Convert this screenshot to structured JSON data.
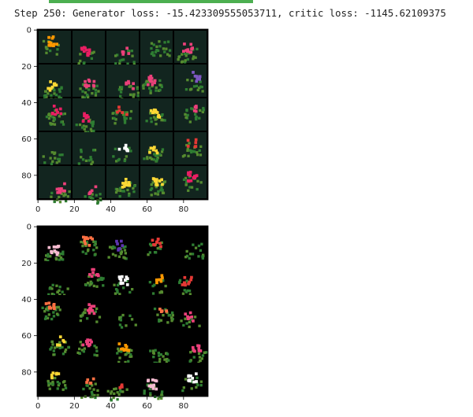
{
  "progress": {
    "fraction": 1.0,
    "color": "#4caf50"
  },
  "log": {
    "text": "Step 250: Generator loss: -15.423309555053711, critic loss: -1145.62109375"
  },
  "plots": [
    {
      "name": "generated-samples",
      "x_ticks": [
        "0",
        "20",
        "40",
        "60",
        "80"
      ],
      "y_ticks": [
        "0",
        "20",
        "40",
        "60",
        "80"
      ],
      "grid": {
        "rows": 5,
        "cols": 5
      },
      "tile_background": "#12251f",
      "frame_background": "#000000",
      "palette": [
        "#e53935",
        "#fdd835",
        "#ffffff",
        "#7e57c2",
        "#ec407a",
        "#ff9800",
        "#e91e63"
      ]
    },
    {
      "name": "real-samples",
      "x_ticks": [
        "0",
        "20",
        "40",
        "60",
        "80"
      ],
      "y_ticks": [
        "0",
        "20",
        "40",
        "60",
        "80"
      ],
      "grid": {
        "rows": 5,
        "cols": 5
      },
      "tile_background": "#000000",
      "frame_background": "#000000",
      "palette": [
        "#ec407a",
        "#fdd835",
        "#ff7043",
        "#e53935",
        "#ffffff",
        "#5e35b1",
        "#ff9800",
        "#f8bbd0"
      ]
    }
  ]
}
